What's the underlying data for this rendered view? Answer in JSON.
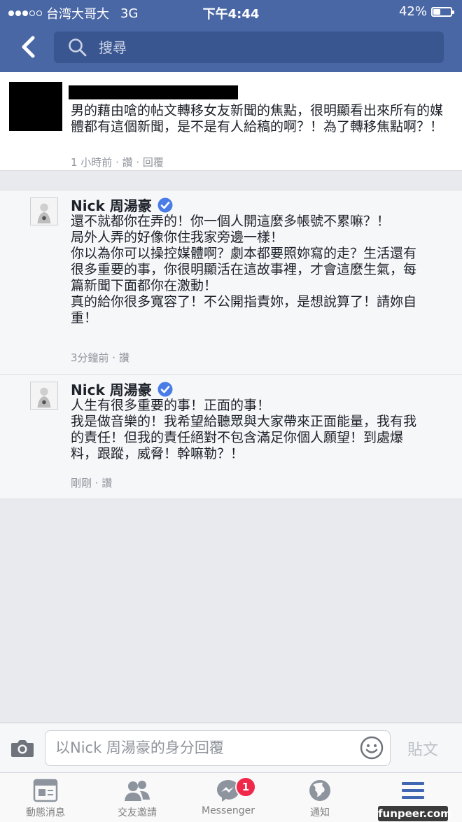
{
  "status_bar": {
    "carrier": "台湾大哥大",
    "network": "3G",
    "time": "下午4:44",
    "battery": "42%",
    "battery_level": 0.42
  },
  "search": {
    "placeholder": "搜尋"
  },
  "comments": {
    "top": {
      "text": "男的藉由嗆的帖文轉移女友新聞的焦點，很明顯看出來所有的媒體都有這個新聞，是不是有人給稿的啊？！為了轉移焦點啊？！",
      "meta": "1 小時前 · 讚 · 回覆"
    },
    "replies": [
      {
        "name": "Nick 周湯豪",
        "text": "還不就都你在弄的！你一個人開這麼多帳號不累嘛？！\n局外人弄的好像你住我家旁邊一樣！\n你以為你可以操控媒體啊？劇本都要照妳寫的走？生活還有很多重要的事，你很明顯活在這故事裡，才會這麼生氣，每篇新聞下面都你在激動！\n真的給你很多寬容了！不公開指責妳，是想說算了！請妳自重！",
        "meta": "3分鐘前 · 讚"
      },
      {
        "name": "Nick 周湯豪",
        "text": "人生有很多重要的事！正面的事！\n我是做音樂的！我希望給聽眾與大家帶來正面能量，我有我的責任！但我的責任絕對不包含滿足你個人願望！到處爆料，跟蹤，威脅！幹嘛勒？！",
        "meta": "剛剛 · 讚"
      }
    ]
  },
  "composer": {
    "placeholder": "以Nick 周湯豪的身分回覆",
    "post_label": "貼文"
  },
  "tabs": [
    {
      "label": "動態消息",
      "icon": "news-feed-icon"
    },
    {
      "label": "交友邀請",
      "icon": "friends-icon"
    },
    {
      "label": "Messenger",
      "icon": "messenger-icon",
      "badge": "1"
    },
    {
      "label": "通知",
      "icon": "globe-icon"
    },
    {
      "label": "",
      "icon": "menu-icon"
    }
  ],
  "watermark": "funpeer.com",
  "colors": {
    "brand": "#4a67a5",
    "active_tab": "#4267b2",
    "badge": "#f02849",
    "verified": "#4a7ce8"
  }
}
